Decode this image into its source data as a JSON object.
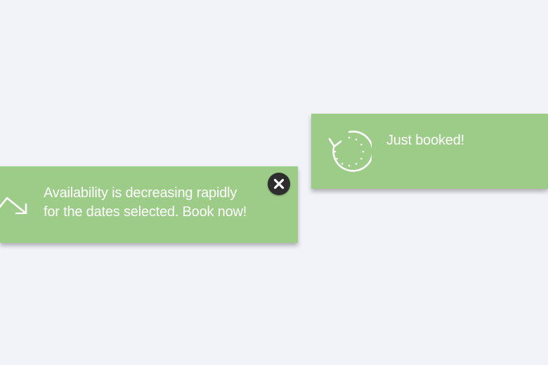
{
  "notifications": {
    "booked": {
      "message": "Just booked!",
      "icon": "clock-rewind-icon"
    },
    "availability": {
      "line1": "Availability is decreasing rapidly",
      "line2": "for the dates selected. Book now!",
      "icon": "trend-down-icon",
      "close_icon": "close-icon"
    }
  },
  "colors": {
    "background": "#f2f3f8",
    "toast_background": "#9ccc87",
    "toast_text": "#ffffff",
    "close_button": "#2e2e2e"
  }
}
